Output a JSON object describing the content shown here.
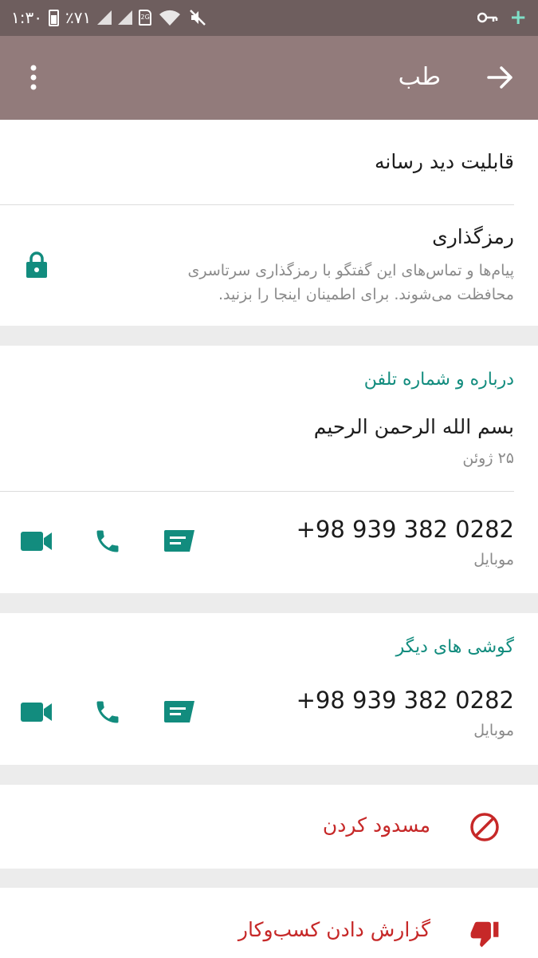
{
  "status_bar": {
    "time": "۱:۳۰",
    "battery_text": "٪۷۱",
    "sim_label": "2G"
  },
  "app_bar": {
    "title": "طب"
  },
  "media_visibility": {
    "label": "قابلیت دید رسانه"
  },
  "encryption": {
    "title": "رمزگذاری",
    "description_line1": "پیام‌ها و تماس‌های این گفتگو با رمزگذاری سرتاسری",
    "description_line2": "محافظت می‌شوند. برای اطمینان اینجا را بزنید."
  },
  "about": {
    "section_title": "درباره و شماره تلفن",
    "status_text": "بسم الله الرحمن الرحیم",
    "status_date": "۲۵ ژوئن",
    "phone": "+98 939 382 0282",
    "phone_type": "موبایل"
  },
  "other_phones": {
    "section_title": "گوشی های دیگر",
    "phone": "+98 939 382 0282",
    "phone_type": "موبایل"
  },
  "block": {
    "label": "مسدود کردن"
  },
  "report": {
    "label": "گزارش دادن کسب‌وکار"
  },
  "colors": {
    "accent": "#128c7e",
    "danger": "#c62828",
    "app_bar": "#927b7b",
    "status_bar": "#6e5e5e"
  }
}
